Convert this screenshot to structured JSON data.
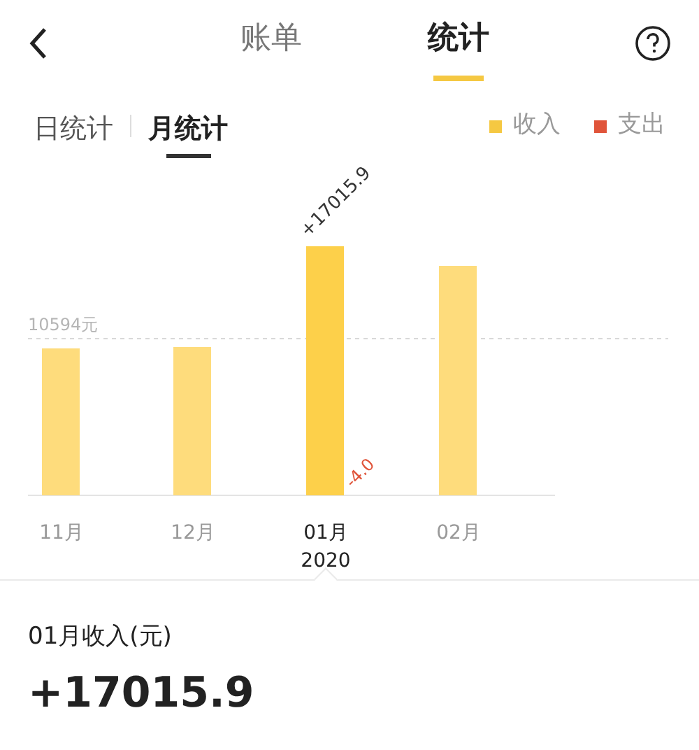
{
  "header": {
    "tabs": [
      {
        "label": "账单",
        "selected": false
      },
      {
        "label": "统计",
        "selected": true
      }
    ]
  },
  "mode_tabs": [
    {
      "label": "日统计",
      "selected": false
    },
    {
      "label": "月统计",
      "selected": true
    }
  ],
  "chart": {
    "legend": [
      {
        "name": "收入",
        "color": "#f5c842"
      },
      {
        "name": "支出",
        "color": "#e0543a"
      }
    ],
    "average": {
      "label": "10594元"
    },
    "months": [
      {
        "label": "11月",
        "selected": false
      },
      {
        "label": "12月",
        "selected": false
      },
      {
        "label": "01月",
        "selected": true,
        "year": "2020",
        "income_label": "+17015.9",
        "expense_label": "-4.0"
      },
      {
        "label": "02月",
        "selected": false
      }
    ]
  },
  "summary": {
    "title": "01月收入(元)",
    "amount": "+17015.9"
  }
}
